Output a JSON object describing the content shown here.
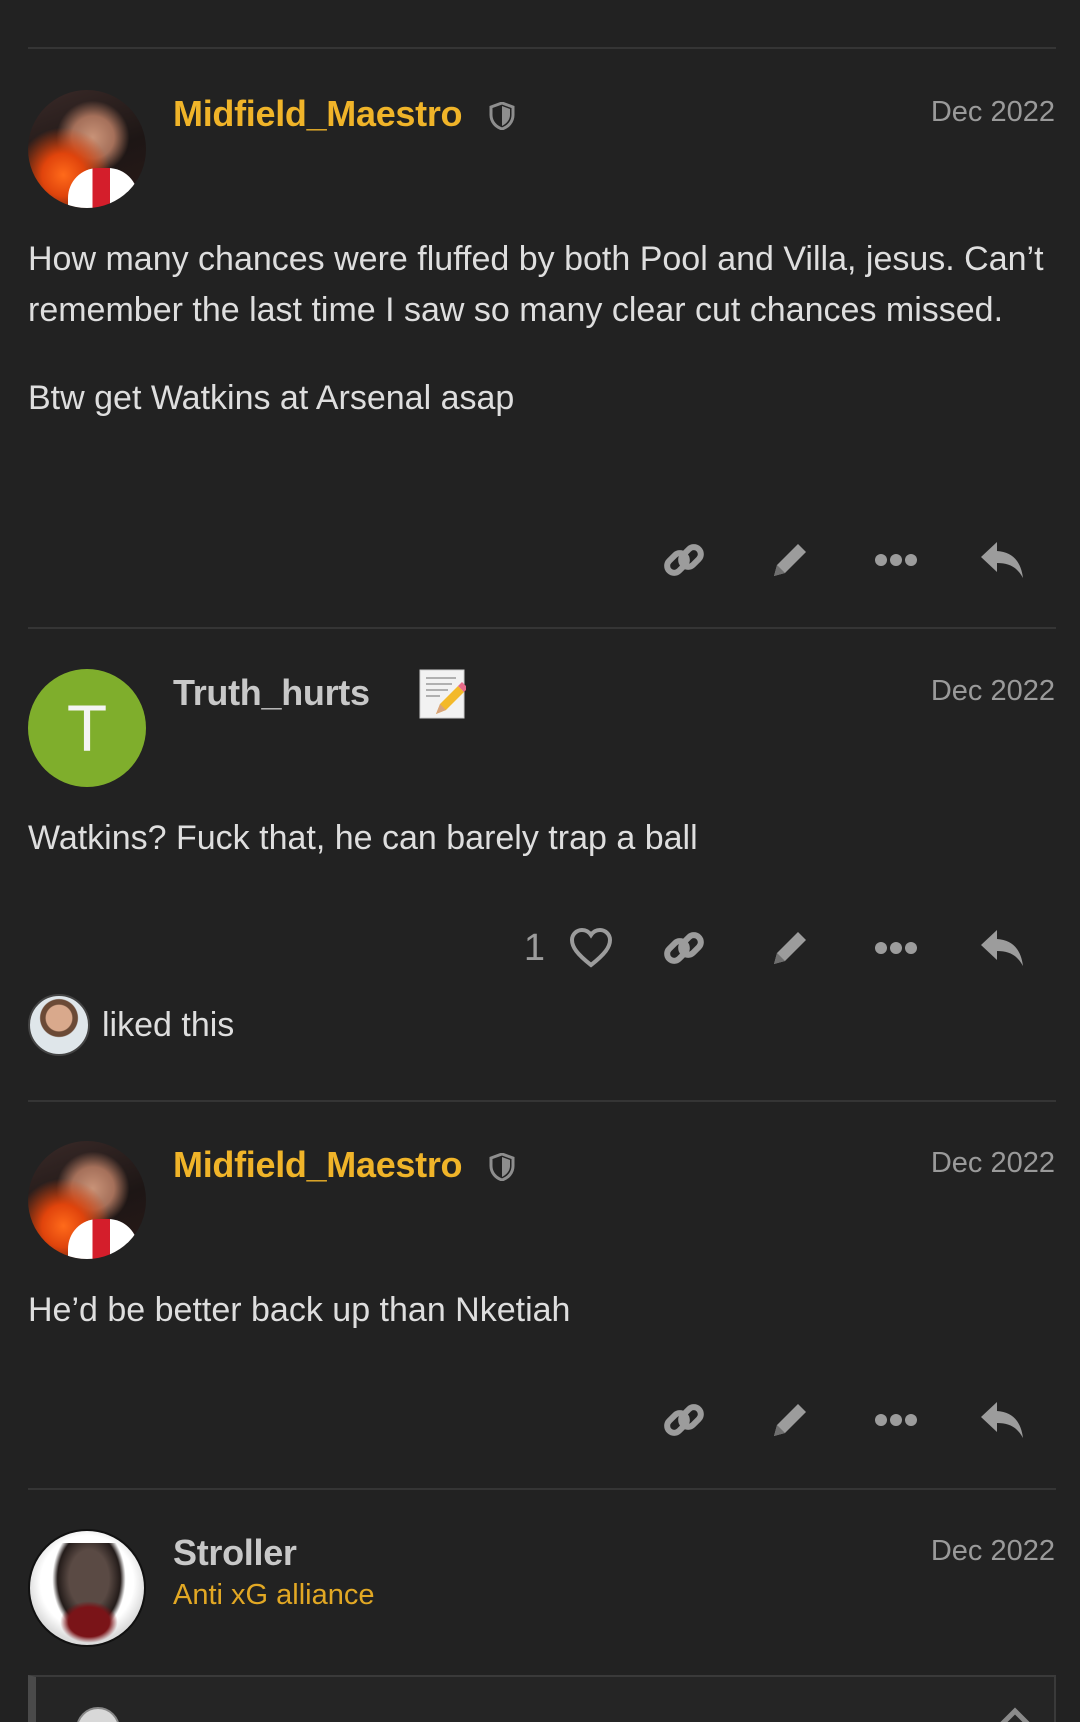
{
  "posts": [
    {
      "username": "Midfield_Maestro",
      "date": "Dec 2022",
      "avatar": "player-photo",
      "badge_icon": "shield-icon",
      "paragraphs": [
        "How many chances were fluffed by both Pool and Villa, jesus. Can’t remember the last time I saw so many clear cut chances missed.",
        "Btw get Watkins at Arsenal asap"
      ]
    },
    {
      "username": "Truth_hurts",
      "date": "Dec 2022",
      "avatar_letter": "T",
      "badge_icon": "memo-icon",
      "paragraphs": [
        "Watkins? Fuck that, he can barely trap a ball"
      ],
      "like_count": "1",
      "liked_text": "liked this"
    },
    {
      "username": "Midfield_Maestro",
      "date": "Dec 2022",
      "avatar": "player-photo",
      "badge_icon": "shield-icon",
      "paragraphs": [
        "He’d be better back up than Nketiah"
      ]
    },
    {
      "username": "Stroller",
      "user_title": "Anti xG alliance",
      "date": "Dec 2022",
      "avatar": "skull-ace-photo"
    }
  ],
  "colors": {
    "background": "#222222",
    "username_gold": "#f0b429",
    "divider": "#353535",
    "icon_gray": "#9c9c9c"
  }
}
